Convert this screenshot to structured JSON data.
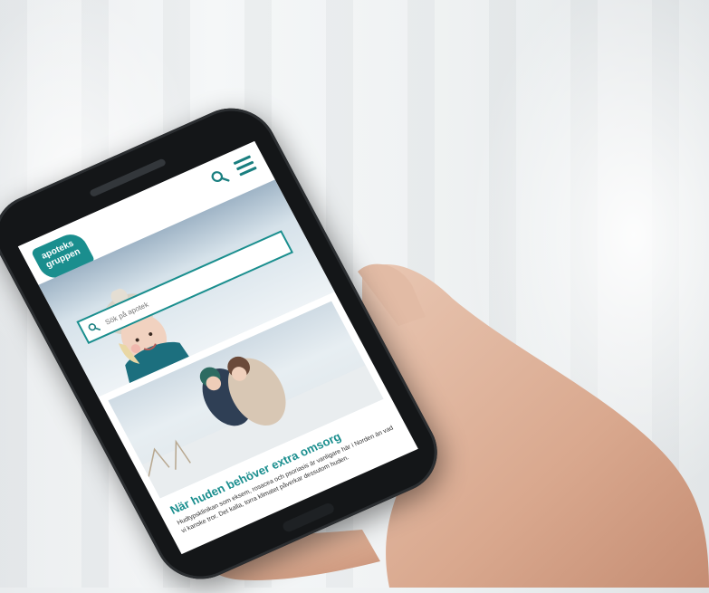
{
  "site": {
    "logo_text": "apoteks\ngruppen",
    "search_placeholder": "Sök på apotek",
    "article_title": "När huden behöver extra omsorg",
    "article_text": "Hudtypsklinikan som eksem, rosacea och psoriasis är vanligare här i Norden än vad vi kanske tror. Det kalla, torra klimatet påverkar dessutom huden."
  },
  "colors": {
    "brand": "#1a8e8e",
    "phone_body": "#141618"
  }
}
